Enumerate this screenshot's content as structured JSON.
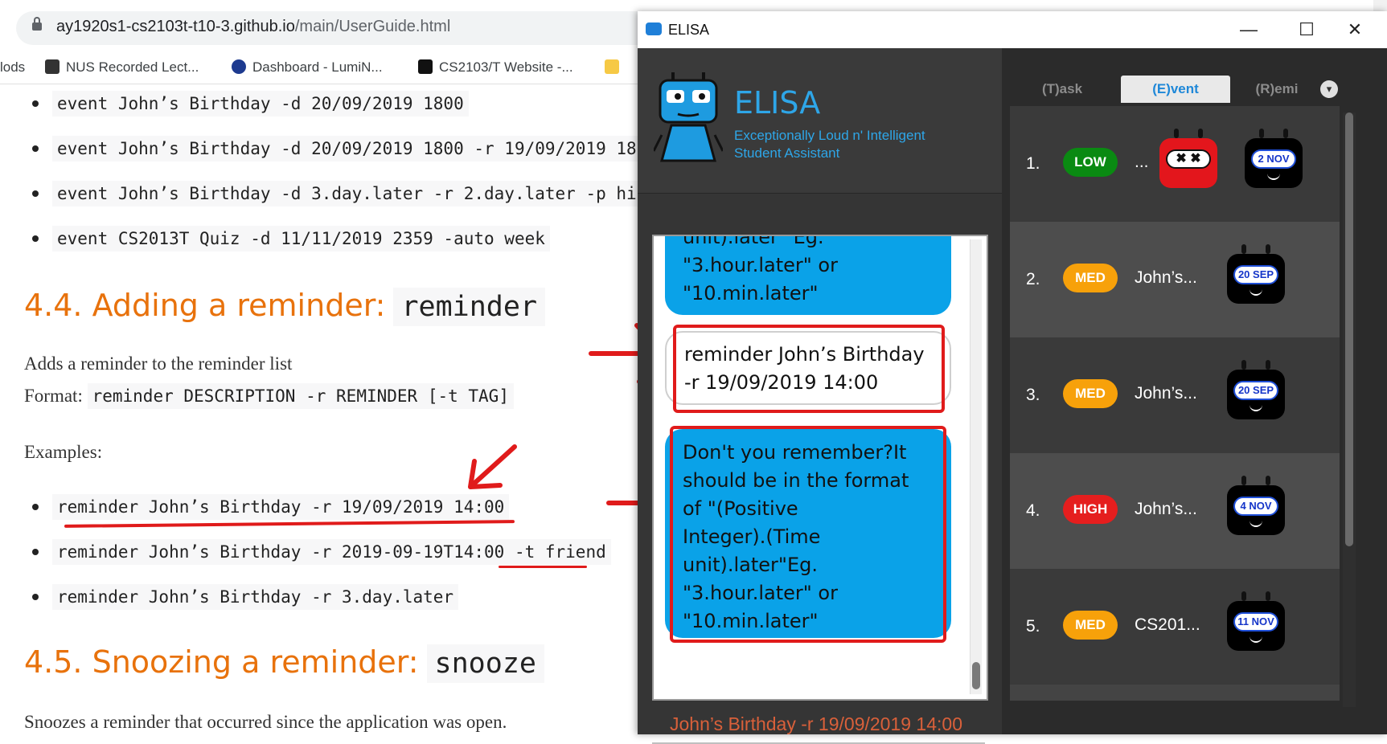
{
  "browser": {
    "url_host": "ay1920s1-cs2103t-t10-3.github.io",
    "url_path": "/main/UserGuide.html",
    "bookmarks": [
      {
        "label": "lods"
      },
      {
        "label": "NUS Recorded Lect..."
      },
      {
        "label": "Dashboard - LumiN..."
      },
      {
        "label": "CS2103/T Website -..."
      }
    ]
  },
  "doc": {
    "event_examples": [
      "event John’s Birthday -d 20/09/2019 1800",
      "event John’s Birthday -d 20/09/2019 1800 -r 19/09/2019 18",
      "event John’s Birthday -d 3.day.later -r 2.day.later -p hi",
      "event CS2013T Quiz -d 11/11/2019 2359 -auto week"
    ],
    "section_44_title": "4.4. Adding a reminder:",
    "section_44_code": "reminder",
    "section_44_desc": "Adds a reminder to the reminder list",
    "format_label": "Format:",
    "format_code": "reminder DESCRIPTION -r REMINDER [-t TAG]",
    "examples_label": "Examples:",
    "reminder_examples": [
      "reminder John’s Birthday -r 19/09/2019 14:00",
      "reminder John’s Birthday -r 2019-09-19T14:00 -t friend",
      "reminder John’s Birthday -r 3.day.later"
    ],
    "section_45_title": "4.5. Snoozing a reminder:",
    "section_45_code": "snooze",
    "section_45_desc": "Snoozes a reminder that occurred since the application was open."
  },
  "elisa": {
    "window_title": "ELISA",
    "controls": {
      "minimize": "—",
      "maximize": "☐",
      "close": "✕"
    },
    "app_name": "ELISA",
    "subtitle_line1": "Exceptionally Loud n' Intelligent",
    "subtitle_line2": "Student Assistant",
    "chat": {
      "bubble1_lines": [
        "unit).later\" Eg.",
        "\"3.hour.later\" or",
        "\"10.min.later\""
      ],
      "user_lines": [
        "reminder John’s Birthday",
        "-r 19/09/2019 14:00"
      ],
      "reply_lines": [
        "Don't you remember?It",
        "should be in the format",
        "of \"(Positive",
        "Integer).(Time",
        "unit).later\"Eg.",
        "\"3.hour.later\" or",
        "\"10.min.later\""
      ]
    },
    "command_input": "John’s Birthday -r 19/09/2019 14:00",
    "tabs": [
      "(T)ask",
      "(E)vent",
      "(R)emi"
    ],
    "tab_arrow": "▾",
    "events": [
      {
        "index": "1.",
        "priority": "LOW",
        "priority_color": "#0a8a12",
        "description": "...",
        "date": "2 NOV"
      },
      {
        "index": "2.",
        "priority": "MED",
        "priority_color": "#f7a10a",
        "description": "John’s...",
        "date": "20 SEP"
      },
      {
        "index": "3.",
        "priority": "MED",
        "priority_color": "#f7a10a",
        "description": "John’s...",
        "date": "20 SEP"
      },
      {
        "index": "4.",
        "priority": "HIGH",
        "priority_color": "#e51e1e",
        "description": "John’s...",
        "date": "4 NOV"
      },
      {
        "index": "5.",
        "priority": "MED",
        "priority_color": "#f7a10a",
        "description": "CS201...",
        "date": "11 NOV"
      }
    ],
    "angry_bot_face": "✖ ✖"
  }
}
